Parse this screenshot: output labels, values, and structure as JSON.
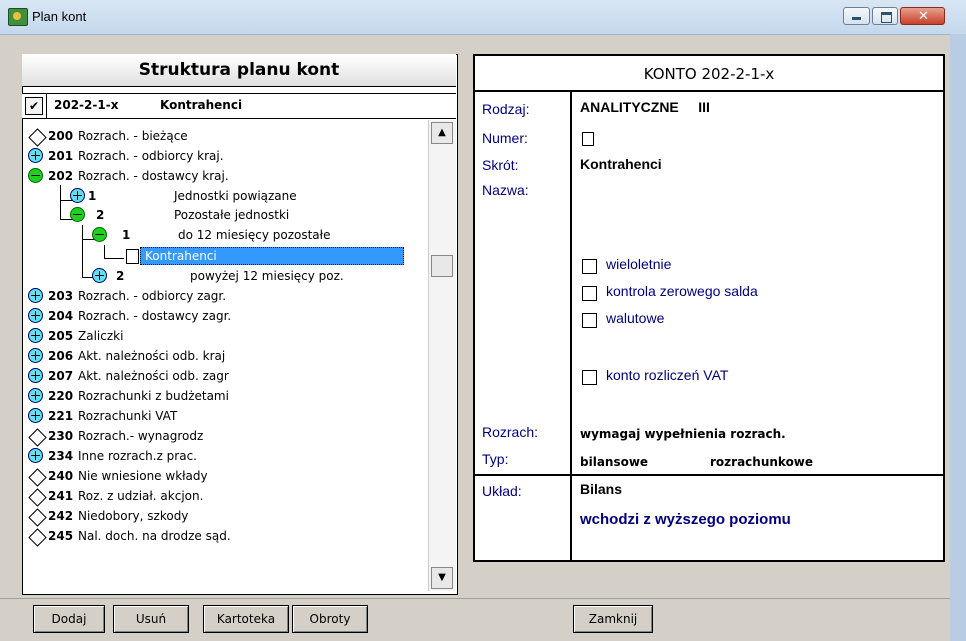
{
  "window": {
    "title": "Plan kont"
  },
  "left": {
    "header": "Struktura planu kont",
    "selected_code": "202-2-1-x",
    "selected_name": "Kontrahenci",
    "tree": [
      {
        "code": "200",
        "label": "Rozrach. - bieżące",
        "icon": "diamond"
      },
      {
        "code": "201",
        "label": "Rozrach. - odbiorcy kraj.",
        "icon": "plus"
      },
      {
        "code": "202",
        "label": "Rozrach. - dostawcy kraj.",
        "icon": "minus"
      },
      {
        "code": "1",
        "label": "Jednostki powiązane",
        "icon": "plus"
      },
      {
        "code": "2",
        "label": "Pozostałe jednostki",
        "icon": "minus"
      },
      {
        "code": "1",
        "label": "do 12 miesięcy pozostałe",
        "icon": "minus"
      },
      {
        "code": "",
        "label": "Kontrahenci",
        "icon": "doc"
      },
      {
        "code": "2",
        "label": "powyżej 12 miesięcy poz.",
        "icon": "plus"
      },
      {
        "code": "203",
        "label": "Rozrach. - odbiorcy zagr.",
        "icon": "plus"
      },
      {
        "code": "204",
        "label": "Rozrach. - dostawcy zagr.",
        "icon": "plus"
      },
      {
        "code": "205",
        "label": "Zaliczki",
        "icon": "plus"
      },
      {
        "code": "206",
        "label": "Akt. należności odb. kraj",
        "icon": "plus"
      },
      {
        "code": "207",
        "label": "Akt. należności odb. zagr",
        "icon": "plus"
      },
      {
        "code": "220",
        "label": "Rozrachunki z budżetami",
        "icon": "plus"
      },
      {
        "code": "221",
        "label": "Rozrachunki VAT",
        "icon": "plus"
      },
      {
        "code": "230",
        "label": "Rozrach.- wynagrodz",
        "icon": "diamond"
      },
      {
        "code": "234",
        "label": "Inne rozrach.z prac.",
        "icon": "plus"
      },
      {
        "code": "240",
        "label": "Nie wniesione wkłady",
        "icon": "diamond"
      },
      {
        "code": "241",
        "label": "Roz. z udział. akcjon.",
        "icon": "diamond"
      },
      {
        "code": "242",
        "label": "Niedobory, szkody",
        "icon": "diamond"
      },
      {
        "code": "245",
        "label": "Nal. doch. na drodze sąd.",
        "icon": "diamond"
      }
    ]
  },
  "right": {
    "header": "KONTO  202-2-1-x",
    "labels": {
      "rodzaj": "Rodzaj:",
      "numer": "Numer:",
      "skrot": "Skrót:",
      "nazwa": "Nazwa:",
      "rozrach": "Rozrach:",
      "typ": "Typ:",
      "uklad": "Układ:"
    },
    "rodzaj": "ANALITYCZNE     III",
    "skrot": "Kontrahenci",
    "checkboxes": [
      "wieloletnie",
      "kontrola zerowego salda",
      "walutowe",
      "konto rozliczeń VAT"
    ],
    "rozrach": "wymagaj wypełnienia rozrach.",
    "typ1": "bilansowe",
    "typ2": "rozrachunkowe",
    "uklad1": "Bilans",
    "uklad2": "wchodzi z wyższego poziomu"
  },
  "buttons": {
    "dodaj": "Dodaj",
    "usun": "Usuń",
    "kartoteka": "Kartoteka",
    "obroty": "Obroty",
    "zamknij": "Zamknij"
  }
}
